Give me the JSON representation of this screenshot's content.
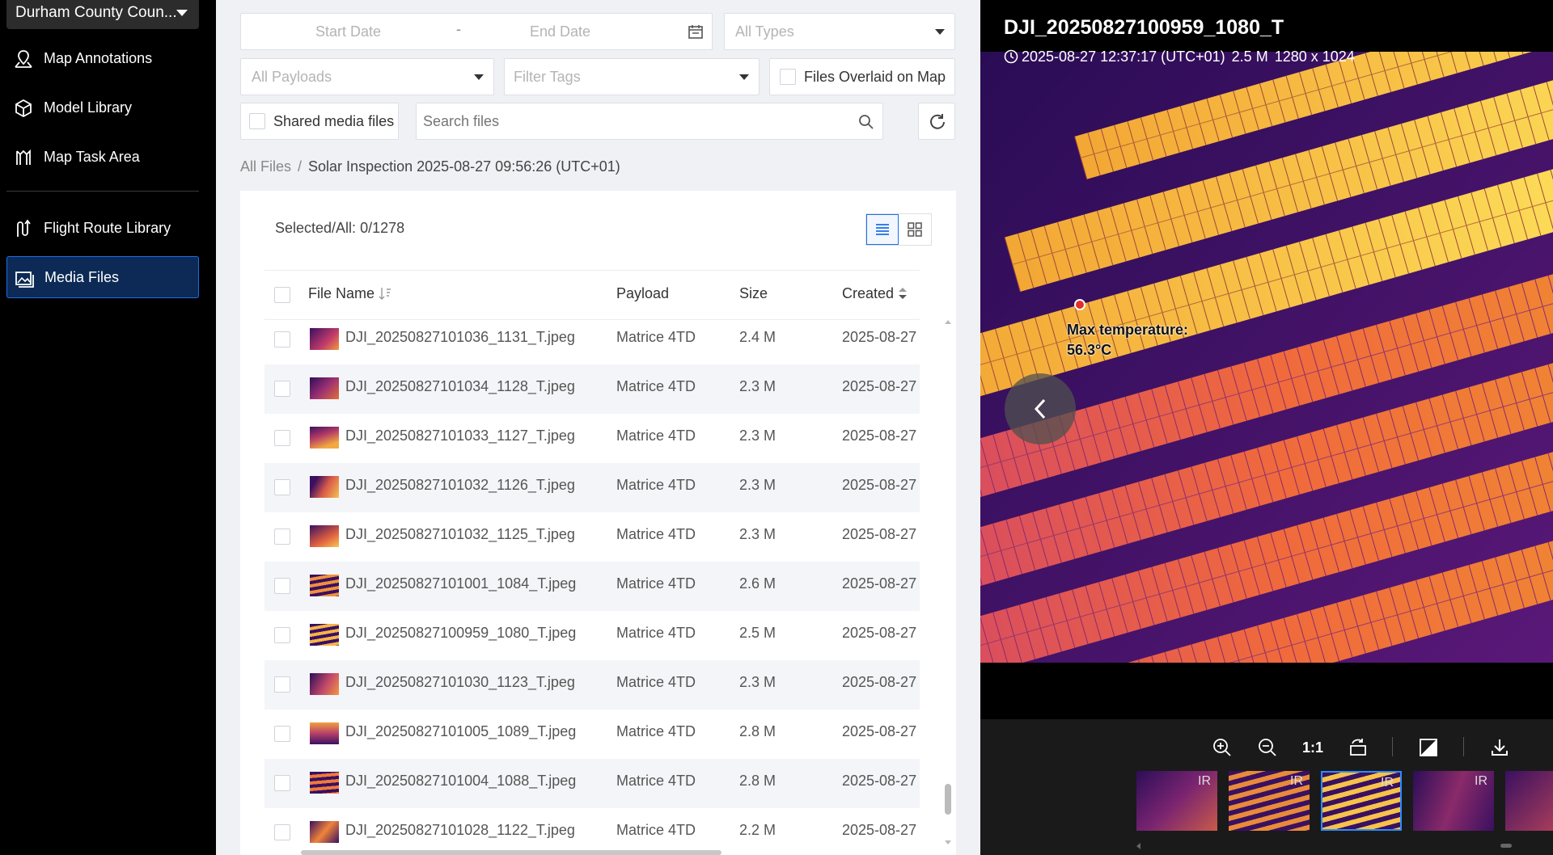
{
  "sidebar": {
    "org": "Durham County Coun...",
    "items": [
      {
        "label": "Map Annotations",
        "icon": "map-annotation-icon"
      },
      {
        "label": "Model Library",
        "icon": "cube-icon"
      },
      {
        "label": "Map Task Area",
        "icon": "task-area-icon"
      },
      {
        "label": "Flight Route Library",
        "icon": "route-icon"
      },
      {
        "label": "Media Files",
        "icon": "image-icon",
        "active": true
      }
    ]
  },
  "filters": {
    "start_date": "Start Date",
    "date_sep": "-",
    "end_date": "End Date",
    "types": "All Types",
    "payloads": "All Payloads",
    "tags": "Filter Tags",
    "overlaid": "Files Overlaid on Map",
    "shared": "Shared media files",
    "search_placeholder": "Search files"
  },
  "breadcrumb": {
    "root": "All Files",
    "sep": "/",
    "current": "Solar Inspection 2025-08-27 09:56:26 (UTC+01)"
  },
  "table": {
    "selected_label": "Selected/All:",
    "selected_value": "0/1278",
    "headers": {
      "name": "File Name",
      "payload": "Payload",
      "size": "Size",
      "created": "Created"
    },
    "rows": [
      {
        "name": "DJI_20250827101036_1131_T.jpeg",
        "payload": "Matrice 4TD",
        "size": "2.4 M",
        "created": "2025-08-27"
      },
      {
        "name": "DJI_20250827101034_1128_T.jpeg",
        "payload": "Matrice 4TD",
        "size": "2.3 M",
        "created": "2025-08-27"
      },
      {
        "name": "DJI_20250827101033_1127_T.jpeg",
        "payload": "Matrice 4TD",
        "size": "2.3 M",
        "created": "2025-08-27"
      },
      {
        "name": "DJI_20250827101032_1126_T.jpeg",
        "payload": "Matrice 4TD",
        "size": "2.3 M",
        "created": "2025-08-27"
      },
      {
        "name": "DJI_20250827101032_1125_T.jpeg",
        "payload": "Matrice 4TD",
        "size": "2.3 M",
        "created": "2025-08-27"
      },
      {
        "name": "DJI_20250827101001_1084_T.jpeg",
        "payload": "Matrice 4TD",
        "size": "2.6 M",
        "created": "2025-08-27"
      },
      {
        "name": "DJI_20250827100959_1080_T.jpeg",
        "payload": "Matrice 4TD",
        "size": "2.5 M",
        "created": "2025-08-27"
      },
      {
        "name": "DJI_20250827101030_1123_T.jpeg",
        "payload": "Matrice 4TD",
        "size": "2.3 M",
        "created": "2025-08-27"
      },
      {
        "name": "DJI_20250827101005_1089_T.jpeg",
        "payload": "Matrice 4TD",
        "size": "2.8 M",
        "created": "2025-08-27"
      },
      {
        "name": "DJI_20250827101004_1088_T.jpeg",
        "payload": "Matrice 4TD",
        "size": "2.8 M",
        "created": "2025-08-27"
      },
      {
        "name": "DJI_20250827101028_1122_T.jpeg",
        "payload": "Matrice 4TD",
        "size": "2.2 M",
        "created": "2025-08-27"
      }
    ]
  },
  "viewer": {
    "title": "DJI_20250827100959_1080_T",
    "datetime": "2025-08-27 12:37:17 (UTC+01)",
    "size": "2.5 M",
    "resolution": "1280 x 1024",
    "max_temp_label": "Max temperature:",
    "max_temp_value": "56.3°C",
    "zoom_label": "1:1",
    "thumb_badge": "IR"
  },
  "colors": {
    "accent": "#1e6ee8",
    "active_nav_bg": "#0c2a55",
    "thermal_bg": "#3a0f6e",
    "thermal_panel": "#f57a1c"
  }
}
